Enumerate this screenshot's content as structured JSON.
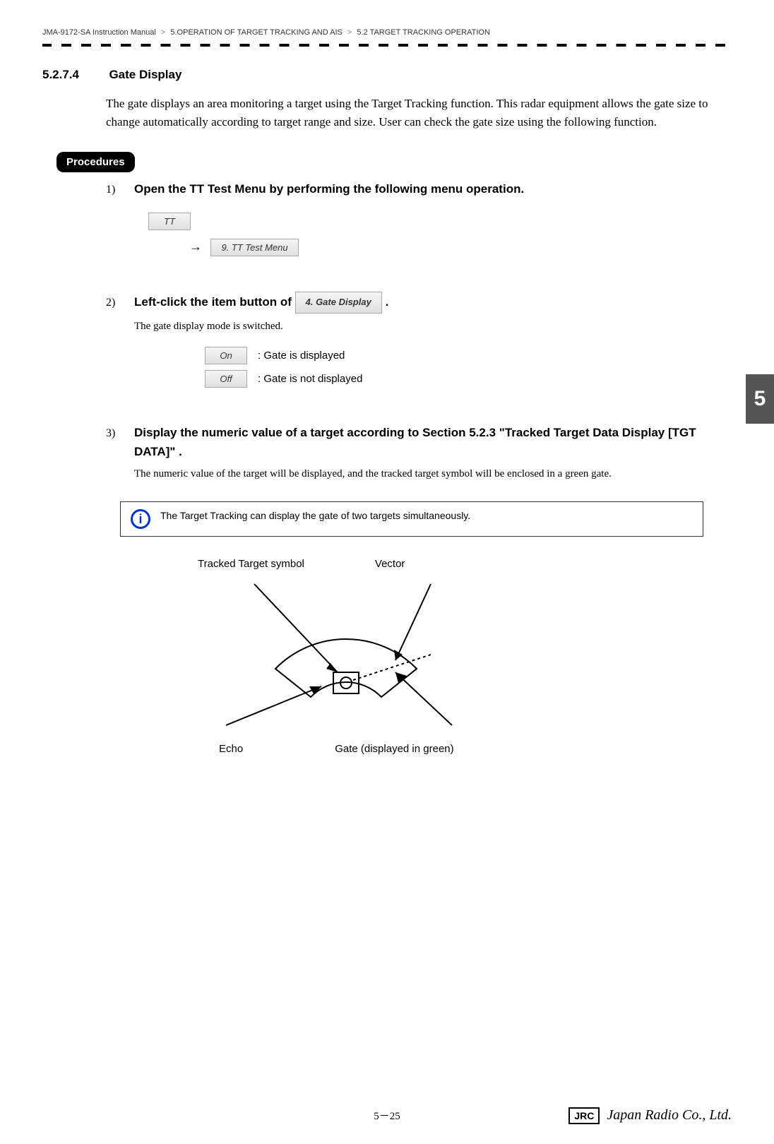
{
  "breadcrumb": {
    "part1": "JMA-9172-SA Instruction Manual",
    "sep": ">",
    "part2": "5.OPERATION OF TARGET TRACKING AND AIS",
    "part3": "5.2  TARGET TRACKING OPERATION"
  },
  "section": {
    "number": "5.2.7.4",
    "title": "Gate Display"
  },
  "intro": "The gate displays an area monitoring a target using the Target Tracking function. This radar equipment allows the gate size to change automatically according to target range and size. User can check the gate size using the following function.",
  "procedures_label": "Procedures",
  "steps": {
    "s1": {
      "num": "1)",
      "title": " Open the TT Test Menu by performing the following menu operation.",
      "btn_tt": "TT",
      "arrow": "→",
      "btn_menu": "9. TT Test Menu"
    },
    "s2": {
      "num": "2)",
      "title_pre": "Left-click the item button of ",
      "btn_gate": "4. Gate Display",
      "title_post": " .",
      "desc": "The gate display mode is switched.",
      "opt_on": "On",
      "opt_on_desc": ": Gate is displayed",
      "opt_off": "Off",
      "opt_off_desc": ": Gate is not displayed"
    },
    "s3": {
      "num": "3)",
      "title": "Display the numeric value of a target according to Section 5.2.3 \"Tracked Target Data Display [TGT DATA]\" .",
      "desc": "The numeric value of the target will be displayed, and the tracked target symbol will be enclosed in a green gate."
    }
  },
  "info": {
    "icon": "i",
    "text": "The Target Tracking can display the gate of two targets simultaneously."
  },
  "diagram": {
    "label_tracked": "Tracked Target symbol",
    "label_vector": "Vector",
    "label_echo": "Echo",
    "label_gate": "Gate (displayed in green)"
  },
  "side_tab": "5",
  "footer": {
    "page": "5－25",
    "jrc": "JRC",
    "company": "Japan Radio Co., Ltd."
  }
}
